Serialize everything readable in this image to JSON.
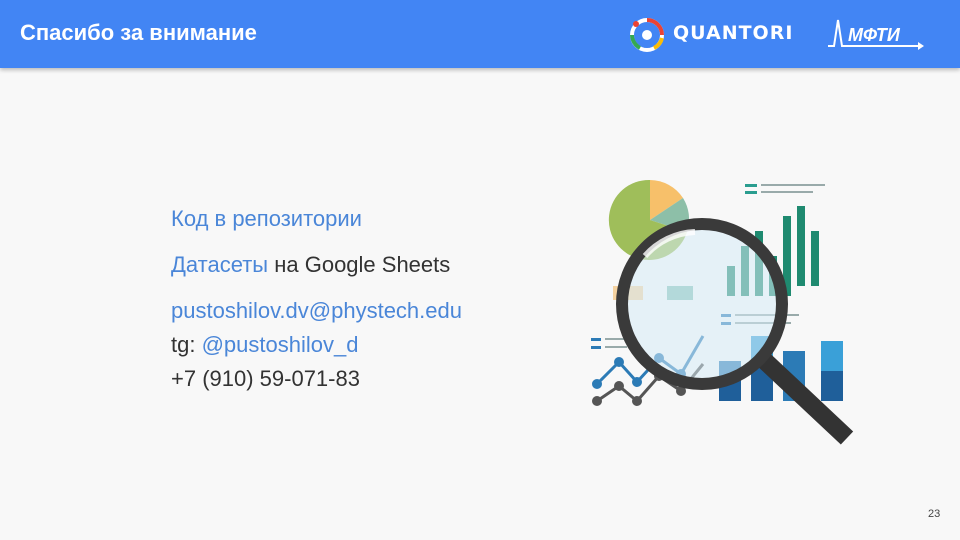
{
  "header": {
    "title": "Спасибо за внимание",
    "partner_logo": "QUANTORI",
    "university_logo": "МФТИ"
  },
  "content": {
    "repo_link": "Код в репозитории",
    "datasets_link": "Датасеты",
    "datasets_suffix": " на Google Sheets",
    "email": "pustoshilov.dv@phystech.edu",
    "tg_prefix": "tg: ",
    "tg_handle": "@pustoshilov_d",
    "phone": "+7 (910) 59-071-83"
  },
  "illustration": "magnifier-over-charts",
  "page_number": "23",
  "colors": {
    "header_bg": "#4285f4",
    "link": "#4a86d8",
    "text": "#333333",
    "background": "#f8f8f8"
  }
}
